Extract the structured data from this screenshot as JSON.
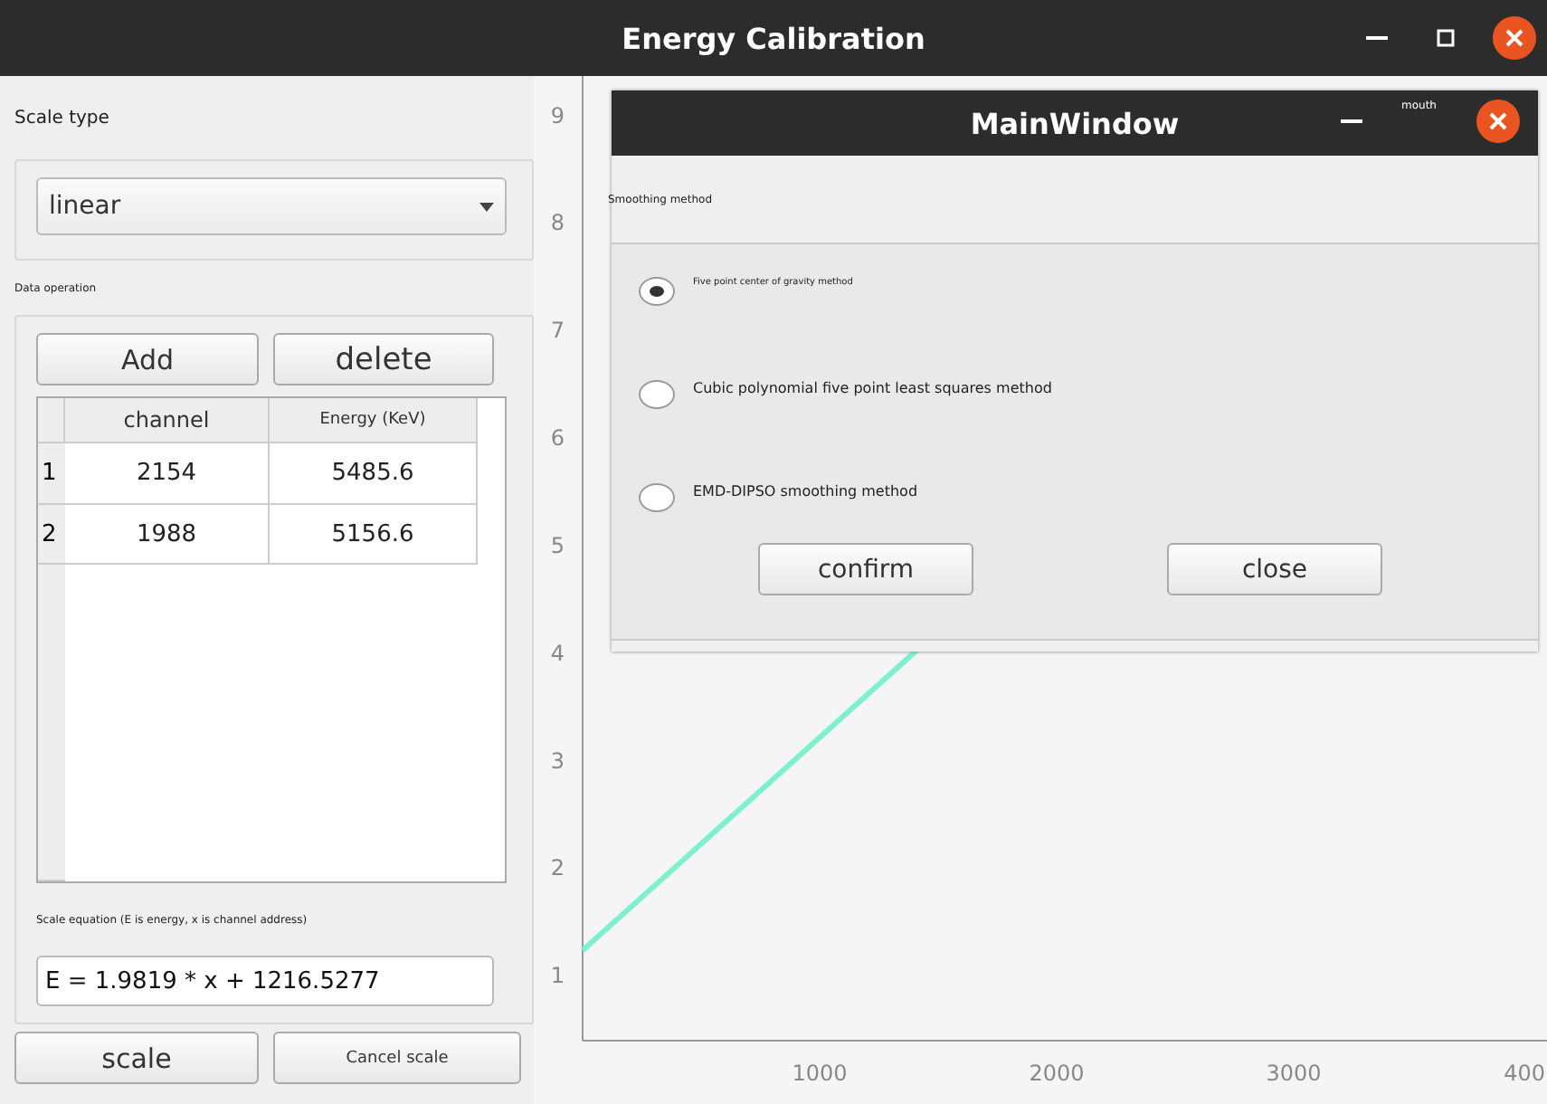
{
  "window": {
    "title": "Energy Calibration"
  },
  "scale_type": {
    "label": "Scale type",
    "value": "linear"
  },
  "data_operation": {
    "label": "Data operation",
    "buttons": [
      "Add",
      "delete"
    ]
  },
  "table": {
    "columns": [
      "channel",
      "Energy (KeV)"
    ],
    "rows": [
      {
        "index": "1",
        "cells": [
          "2154",
          "5485.6"
        ]
      },
      {
        "index": "2",
        "cells": [
          "1988",
          "5156.6"
        ]
      }
    ]
  },
  "equation": {
    "label": "Scale equation (E is energy, x is channel address)",
    "value": "E = 1.9819 * x + 1216.5277"
  },
  "footer_buttons": [
    "scale",
    "Cancel scale"
  ],
  "chart": {
    "chart_data": {
      "type": "line",
      "x": [
        0,
        1420
      ],
      "series": [
        {
          "color": "#7ff0cf",
          "values": [
            1.22,
            4.03
          ]
        }
      ],
      "xlim": [
        0,
        4069
      ],
      "ylim": [
        0.38,
        9.35
      ],
      "xticks": [
        1000,
        2000,
        3000
      ],
      "yticks": [
        1,
        2,
        3,
        4,
        5,
        6,
        7,
        8,
        9
      ]
    },
    "edge_tick_label": "400"
  },
  "dialog": {
    "title": "MainWindow",
    "tooltip": "mouth",
    "group_label": "Smoothing method",
    "options": [
      {
        "label": "Five point center of gravity method",
        "selected": true
      },
      {
        "label": "Cubic polynomial five point least squares method",
        "selected": false
      },
      {
        "label": "EMD-DIPSO smoothing method",
        "selected": false
      }
    ],
    "buttons": [
      "confirm",
      "close"
    ]
  }
}
